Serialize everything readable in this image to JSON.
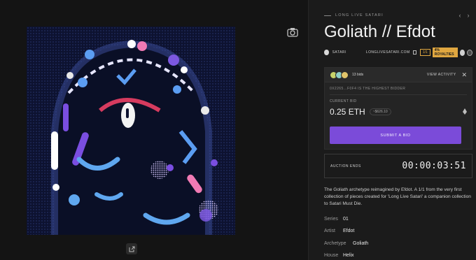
{
  "breadcrumb": {
    "collection": "Long Live Satari"
  },
  "artwork": {
    "title": "Goliath // Efdot"
  },
  "meta": {
    "artist": "SATARI",
    "website": "LONGLIVESATARI.COM",
    "edition": "1/1",
    "royalties": "4% ROYALTIES"
  },
  "bid": {
    "bids_count": "13 bids",
    "view_activity": "VIEW ACTIVITY",
    "highest_bidder": "0X2265...F0F4 IS THE HIGHEST BIDDER",
    "current_label": "CURRENT BID",
    "amount": "0.25 ETH",
    "usd": "~$626.10",
    "submit_label": "SUBMIT A BID"
  },
  "auction": {
    "label": "AUCTION ENDS",
    "timer": "00:00:03:51"
  },
  "description": "The Goliath archetype reimagined by Efdot. A 1/1 from the very first collection of pieces created for 'Long Live Satari' a companion collection to Satari Must Die.",
  "attributes": [
    {
      "key": "Series",
      "value": "01"
    },
    {
      "key": "Artist",
      "value": "Efdot"
    },
    {
      "key": "Archetype",
      "value": "Goliath"
    },
    {
      "key": "House",
      "value": "Helix"
    }
  ],
  "colors": {
    "accent": "#7b4bd9",
    "royalty": "#e0a740",
    "art_bg": "#0d1230"
  }
}
